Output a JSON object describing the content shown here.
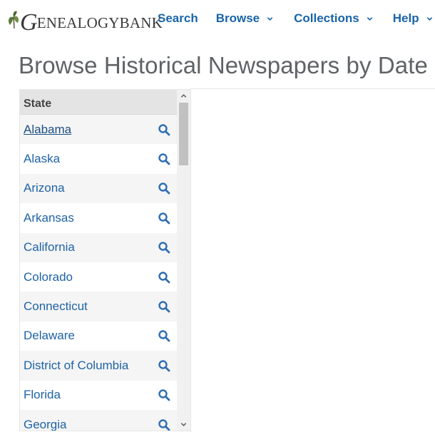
{
  "header": {
    "logo_text": "GENEALOGYBANK",
    "logo_first_letter": "G",
    "logo_rest": "ENEALOGYBANK"
  },
  "nav": {
    "search": "Search",
    "browse": "Browse",
    "collections": "Collections",
    "help": "Help"
  },
  "page_title": "Browse Historical Newspapers by Date",
  "states_panel": {
    "header": "State",
    "items": [
      "Alabama",
      "Alaska",
      "Arizona",
      "Arkansas",
      "California",
      "Colorado",
      "Connecticut",
      "Delaware",
      "District of Columbia",
      "Florida",
      "Georgia"
    ],
    "active_item": "Alabama"
  },
  "colors": {
    "link": "#1e63a6",
    "nav": "#1a64a8",
    "title": "#5f6266",
    "row_alt": "#f5f5f5",
    "header_bg": "#e4e4e4"
  },
  "icons": {
    "logo": "leaf-icon",
    "chevron": "chevron-down-icon",
    "search": "magnifier-icon",
    "scroll_up": "scroll-up-arrow-icon",
    "scroll_down": "scroll-down-arrow-icon"
  }
}
